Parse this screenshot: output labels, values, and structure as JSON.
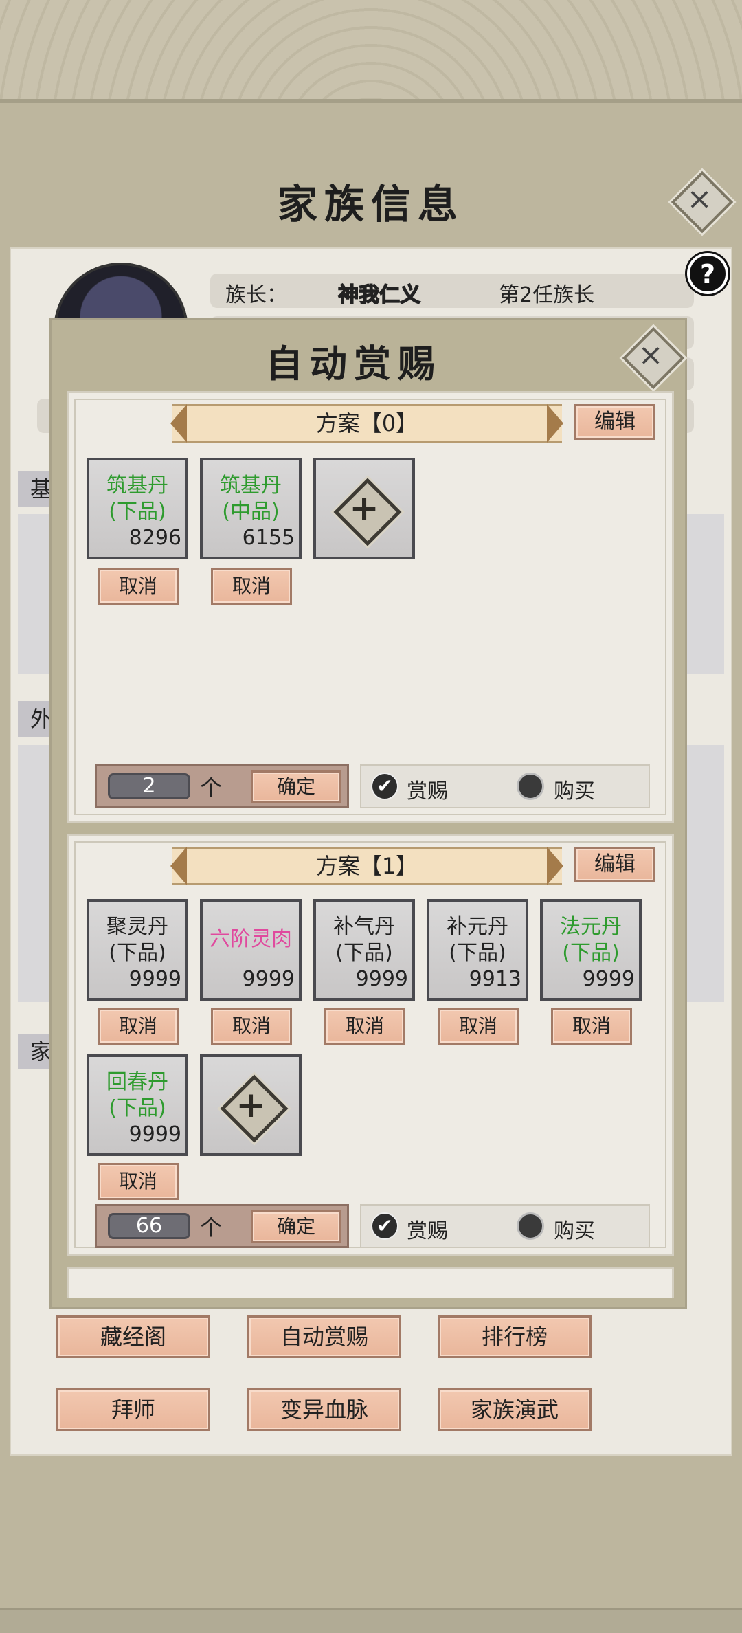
{
  "family": {
    "title": "家族信息",
    "leader_label": "族长：",
    "leader_name": "神我仁义",
    "leader_term": "第2任族长",
    "help": "?",
    "side_tabs": [
      "基",
      "外",
      "家"
    ],
    "buttons": [
      "藏经阁",
      "自动赏赐",
      "排行榜",
      "拜师",
      "变异血脉",
      "家族演武"
    ]
  },
  "modal": {
    "title": "自动赏赐",
    "close": "×",
    "schemes": [
      {
        "label": "方案【0】",
        "edit": "编辑",
        "items": [
          {
            "name1": "筑基丹",
            "name2": "(下品)",
            "count": "8296",
            "color": "#2e9b2e"
          },
          {
            "name1": "筑基丹",
            "name2": "(中品)",
            "count": "6155",
            "color": "#2e9b2e"
          }
        ],
        "cancel": "取消",
        "add_icon": "plus-icon",
        "qty": "2",
        "unit": "个",
        "confirm": "确定",
        "reward": "赏赐",
        "buy": "购买",
        "reward_checked": true
      },
      {
        "label": "方案【1】",
        "edit": "编辑",
        "items": [
          {
            "name1": "聚灵丹",
            "name2": "(下品)",
            "count": "9999",
            "color": "#222222"
          },
          {
            "name1": "六阶灵肉",
            "name2": "",
            "count": "9999",
            "color": "#e04a9e"
          },
          {
            "name1": "补气丹",
            "name2": "(下品)",
            "count": "9999",
            "color": "#222222"
          },
          {
            "name1": "补元丹",
            "name2": "(下品)",
            "count": "9913",
            "color": "#222222"
          },
          {
            "name1": "法元丹",
            "name2": "(下品)",
            "count": "9999",
            "color": "#2e9b2e"
          },
          {
            "name1": "回春丹",
            "name2": "(下品)",
            "count": "9999",
            "color": "#2e9b2e"
          }
        ],
        "cancel": "取消",
        "add_icon": "plus-icon",
        "qty": "66",
        "unit": "个",
        "confirm": "确定",
        "reward": "赏赐",
        "buy": "购买",
        "reward_checked": true
      }
    ]
  }
}
